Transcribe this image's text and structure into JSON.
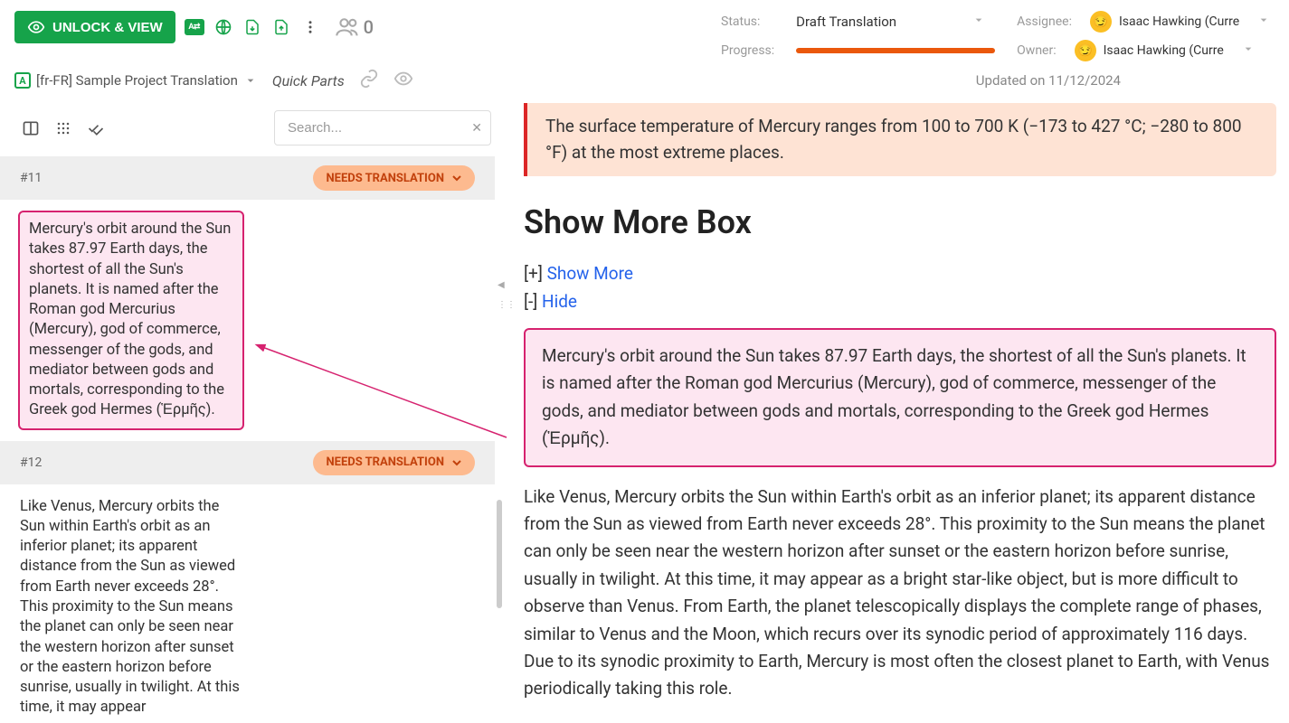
{
  "topbar": {
    "unlock_label": "UNLOCK & VIEW",
    "lang_badge": "A⇄",
    "collab_count": "0"
  },
  "meta": {
    "status_label": "Status:",
    "status_value": "Draft Translation",
    "progress_label": "Progress:",
    "progress_percent": 100,
    "progress_color": "#ea580c",
    "assignee_label": "Assignee:",
    "owner_label": "Owner:",
    "assignee_name": "Isaac Hawking (Curre",
    "owner_name": "Isaac Hawking (Curre"
  },
  "subbar": {
    "doc_title": "[fr-FR] Sample Project Translation",
    "quick_parts": "Quick Parts",
    "updated": "Updated on 11/12/2024"
  },
  "search": {
    "placeholder": "Search..."
  },
  "segments": {
    "s11": {
      "id": "#11",
      "badge": "NEEDS TRANSLATION",
      "text": "Mercury's orbit around the Sun takes 87.97 Earth days, the shortest of all the Sun's planets. It is named after the Roman god Mercurius (Mercury), god of commerce, messenger of the gods, and mediator between gods and mortals, corresponding to the Greek god Hermes (Ἑρμῆς)."
    },
    "s12": {
      "id": "#12",
      "badge": "NEEDS TRANSLATION",
      "text": "Like Venus, Mercury orbits the Sun within Earth's orbit as an inferior planet; its apparent distance from the Sun as viewed from Earth never exceeds 28°. This proximity to the Sun means the planet can only be seen near the western horizon after sunset or the eastern horizon before sunrise, usually in twilight. At this time, it may appear"
    }
  },
  "preview": {
    "callout": "The surface temperature of Mercury ranges from 100 to 700 K (−173 to 427 °C; −280 to 800 °F) at the most extreme places.",
    "heading": "Show More Box",
    "show_more_prefix": "[+] ",
    "show_more": "Show More",
    "hide_prefix": "[-] ",
    "hide": "Hide",
    "p1": "Mercury's orbit around the Sun takes 87.97 Earth days, the shortest of all the Sun's planets. It is named after the Roman god Mercurius (Mercury), god of commerce, messenger of the gods, and mediator between gods and mortals, corresponding to the Greek god Hermes (Ἑρμῆς).",
    "p2": "Like Venus, Mercury orbits the Sun within Earth's orbit as an inferior planet; its apparent distance from the Sun as viewed from Earth never exceeds 28°. This proximity to the Sun means the planet can only be seen near the western horizon after sunset or the eastern horizon before sunrise, usually in twilight. At this time, it may appear as a bright star-like object, but is more difficult to observe than Venus. From Earth, the planet telescopically displays the complete range of phases, similar to Venus and the Moon, which recurs over its synodic period of approximately 116 days. Due to its synodic proximity to Earth, Mercury is most often the closest planet to Earth, with Venus periodically taking this role."
  }
}
